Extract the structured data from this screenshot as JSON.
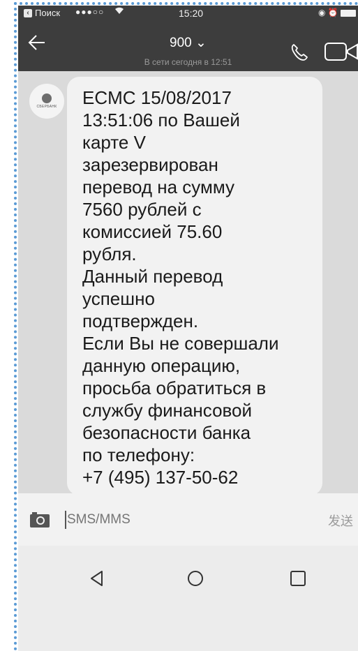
{
  "status_bar": {
    "back_app_label": "Поиск",
    "signal": "●●●○○",
    "time": "15:20"
  },
  "header": {
    "contact_name": "900 ⌄",
    "contact_status": "В сети сегодня в 12:51"
  },
  "message": {
    "text": "ECMC 15/08/2017\n13:51:06 по Вашей\nкарте V\nзарезервирован\nперевод на сумму\n7560 рублей с\nкомиссией 75.60\nрубля.\nДанный перевод\nуспешно\nподтвержден.\nЕсли Вы не совершали\nданную операцию,\nпросьба обратиться в\nслужбу финансовой\nбезопасности банка\nпо телефону:\n+7 (495) 137-50-62"
  },
  "input_bar": {
    "placeholder": "SMS/MMS",
    "send_label": "发送"
  },
  "icons": {
    "back": "back-arrow-icon",
    "call": "phone-call-icon",
    "video": "video-call-icon",
    "camera": "camera-icon",
    "nav_back": "triangle-back-icon",
    "nav_home": "circle-home-icon",
    "nav_recent": "square-recent-icon"
  },
  "colors": {
    "header_bg": "#3d3d3d",
    "chat_bg": "#dadada",
    "bubble_bg": "#f2f2f2",
    "frame_dots": "#5b9bd5"
  }
}
